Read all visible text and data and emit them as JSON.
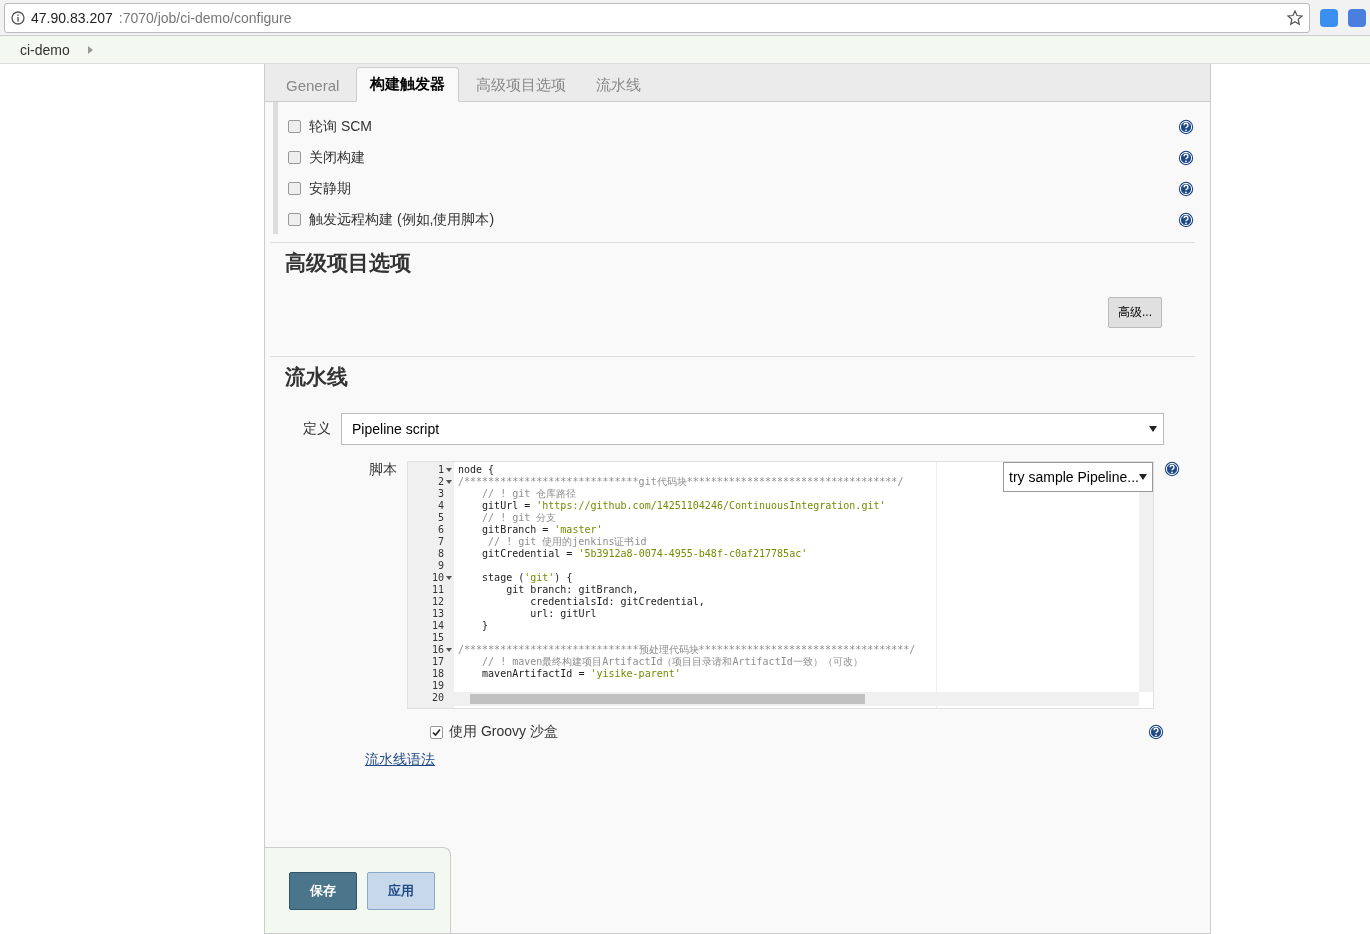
{
  "address_bar": {
    "host": "47.90.83.207",
    "path": ":7070/job/ci-demo/configure"
  },
  "breadcrumb": {
    "items": [
      "ci-demo"
    ]
  },
  "tabs": [
    {
      "label": "General",
      "selected": false
    },
    {
      "label": "构建触发器",
      "selected": true
    },
    {
      "label": "高级项目选项",
      "selected": false
    },
    {
      "label": "流水线",
      "selected": false
    }
  ],
  "triggers": [
    {
      "label": "轮询 SCM",
      "checked": false
    },
    {
      "label": "关闭构建",
      "checked": false
    },
    {
      "label": "安静期",
      "checked": false
    },
    {
      "label": "触发远程构建 (例如,使用脚本)",
      "checked": false
    }
  ],
  "advanced_section": {
    "title": "高级项目选项",
    "button": "高级..."
  },
  "pipeline_section": {
    "title": "流水线",
    "definition_label": "定义",
    "definition_value": "Pipeline script",
    "script_label": "脚本",
    "sample_select": "try sample Pipeline...",
    "code_lines": [
      {
        "num": "1",
        "fold": true,
        "parts": [
          {
            "kind": "plain",
            "text": "node {"
          }
        ]
      },
      {
        "num": "2",
        "fold": true,
        "parts": [
          {
            "kind": "comment",
            "text": "/*****************************git代码块***********************************/"
          }
        ]
      },
      {
        "num": "3",
        "fold": false,
        "parts": [
          {
            "kind": "comment",
            "text": "    // ! git 仓库路径"
          }
        ]
      },
      {
        "num": "4",
        "fold": false,
        "parts": [
          {
            "kind": "plain",
            "text": "    gitUrl = "
          },
          {
            "kind": "string",
            "text": "'https://github.com/14251104246/ContinuousIntegration.git'"
          }
        ]
      },
      {
        "num": "5",
        "fold": false,
        "parts": [
          {
            "kind": "comment",
            "text": "    // ! git 分支"
          }
        ]
      },
      {
        "num": "6",
        "fold": false,
        "parts": [
          {
            "kind": "plain",
            "text": "    gitBranch = "
          },
          {
            "kind": "string",
            "text": "'master'"
          }
        ]
      },
      {
        "num": "7",
        "fold": false,
        "parts": [
          {
            "kind": "comment",
            "text": "     // ! git 使用的jenkins证书id"
          }
        ]
      },
      {
        "num": "8",
        "fold": false,
        "parts": [
          {
            "kind": "plain",
            "text": "    gitCredential = "
          },
          {
            "kind": "string",
            "text": "'5b3912a8-0074-4955-b48f-c0af217785ac'"
          }
        ]
      },
      {
        "num": "9",
        "fold": false
      },
      {
        "num": "10",
        "fold": true,
        "parts": [
          {
            "kind": "plain",
            "text": "    stage ("
          },
          {
            "kind": "string",
            "text": "'git'"
          },
          {
            "kind": "plain",
            "text": ") {"
          }
        ]
      },
      {
        "num": "11",
        "fold": false,
        "parts": [
          {
            "kind": "plain",
            "text": "        git branch: gitBranch,"
          }
        ]
      },
      {
        "num": "12",
        "fold": false,
        "parts": [
          {
            "kind": "plain",
            "text": "            credentialsId: gitCredential,"
          }
        ]
      },
      {
        "num": "13",
        "fold": false,
        "parts": [
          {
            "kind": "plain",
            "text": "            url: gitUrl"
          }
        ]
      },
      {
        "num": "14",
        "fold": false,
        "parts": [
          {
            "kind": "plain",
            "text": "    }"
          }
        ]
      },
      {
        "num": "15",
        "fold": false
      },
      {
        "num": "16",
        "fold": true,
        "parts": [
          {
            "kind": "comment",
            "text": "/*****************************预处理代码块***********************************/"
          }
        ]
      },
      {
        "num": "17",
        "fold": false,
        "parts": [
          {
            "kind": "comment",
            "text": "    // ! maven最终构建项目ArtifactId（项目目录请和ArtifactId一致）（可改）"
          }
        ]
      },
      {
        "num": "18",
        "fold": false,
        "parts": [
          {
            "kind": "plain",
            "text": "    mavenArtifactId = "
          },
          {
            "kind": "string",
            "text": "'yisike-parent'"
          }
        ]
      },
      {
        "num": "19",
        "fold": false
      },
      {
        "num": "20",
        "fold": false
      }
    ],
    "sandbox": {
      "label": "使用 Groovy 沙盒",
      "checked": true
    },
    "syntax_link": "流水线语法"
  },
  "buttons": [
    {
      "label": "保存",
      "kind": "primary"
    },
    {
      "label": "应用",
      "kind": "secondary"
    }
  ]
}
